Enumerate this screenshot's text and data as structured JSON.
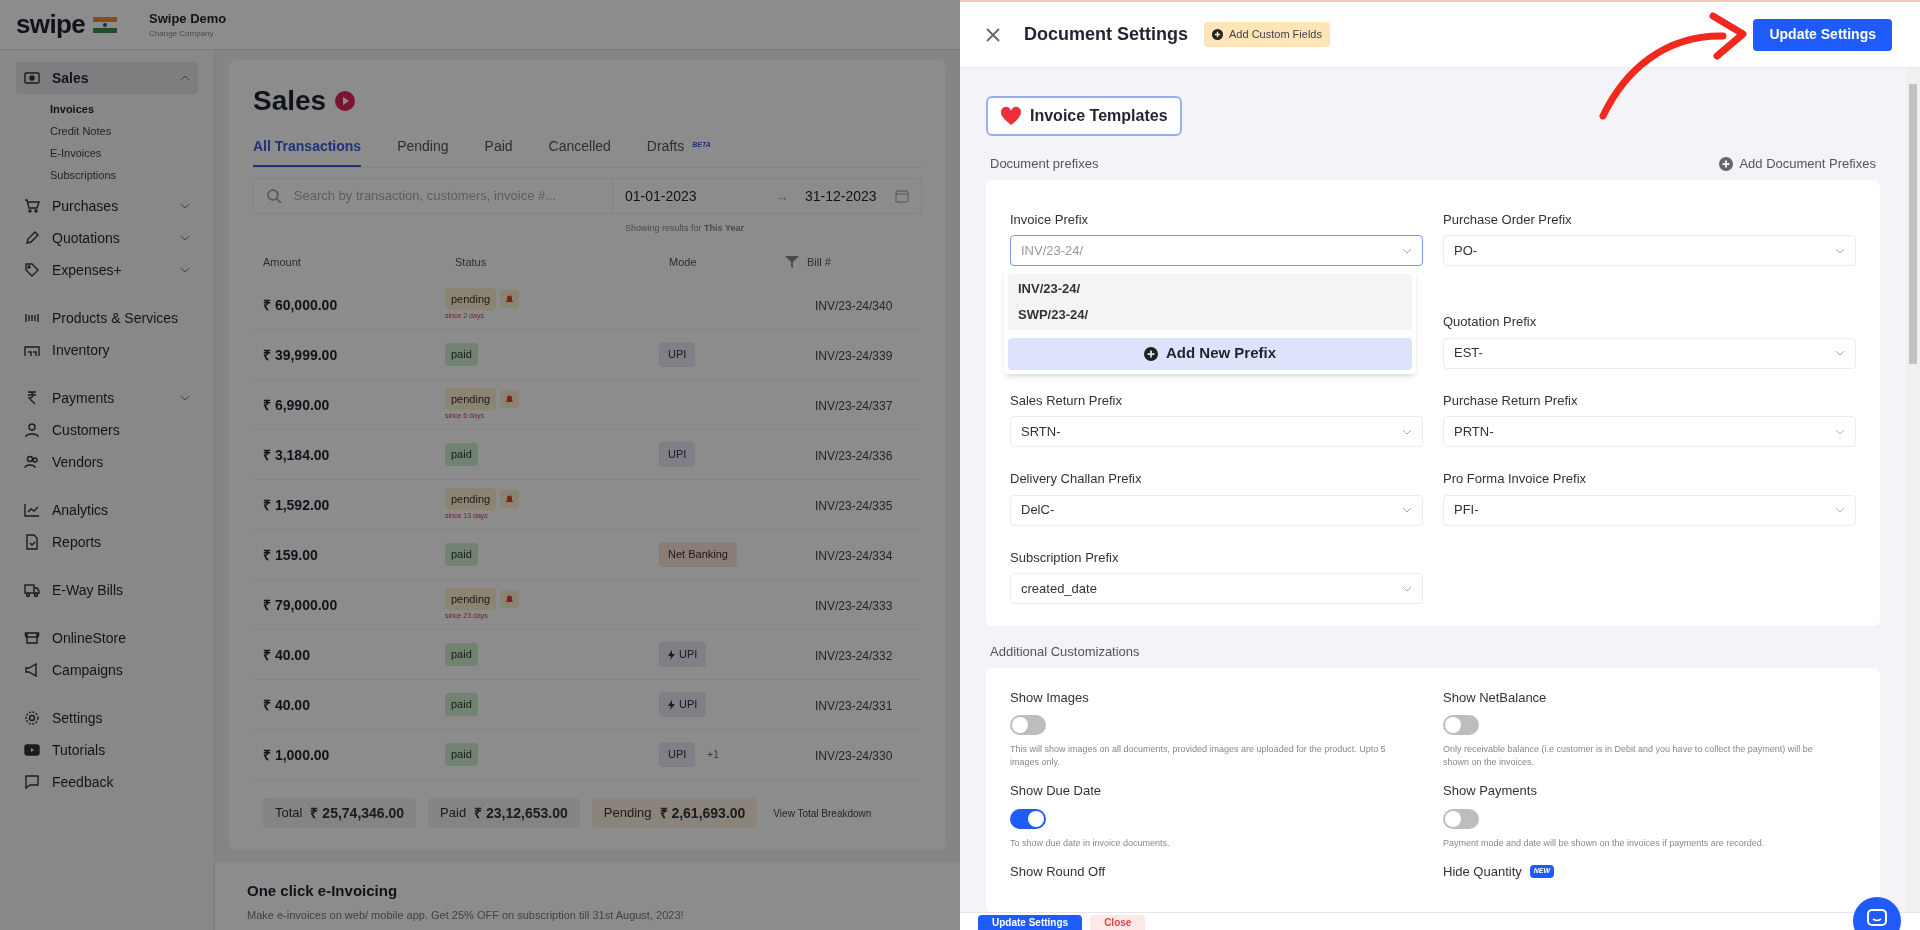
{
  "app": {
    "logo": "swipe",
    "company": "Swipe Demo",
    "change_company": "Change Company"
  },
  "sidebar": {
    "groups": [
      [
        {
          "label": "Sales",
          "selected": true,
          "expanded": true,
          "children": [
            {
              "label": "Invoices",
              "selected": true
            },
            {
              "label": "Credit Notes",
              "selected": false
            },
            {
              "label": "E-Invoices",
              "selected": false
            },
            {
              "label": "Subscriptions",
              "selected": false
            }
          ]
        },
        {
          "label": "Purchases",
          "selected": false,
          "expanded": false
        },
        {
          "label": "Quotations",
          "selected": false,
          "expanded": false
        },
        {
          "label": "Expenses+",
          "selected": false,
          "expanded": false
        }
      ],
      [
        {
          "label": "Products & Services",
          "selected": false
        },
        {
          "label": "Inventory",
          "selected": false
        }
      ],
      [
        {
          "label": "Payments",
          "selected": false,
          "expanded": false
        },
        {
          "label": "Customers",
          "selected": false
        },
        {
          "label": "Vendors",
          "selected": false
        }
      ],
      [
        {
          "label": "Analytics",
          "selected": false
        },
        {
          "label": "Reports",
          "selected": false
        }
      ],
      [
        {
          "label": "E-Way Bills",
          "selected": false
        }
      ],
      [
        {
          "label": "OnlineStore",
          "selected": false
        },
        {
          "label": "Campaigns",
          "selected": false
        }
      ],
      [
        {
          "label": "Settings",
          "selected": false
        },
        {
          "label": "Tutorials",
          "selected": false
        },
        {
          "label": "Feedback",
          "selected": false
        }
      ]
    ]
  },
  "page": {
    "title": "Sales",
    "tabs": [
      {
        "label": "All Transactions",
        "selected": true
      },
      {
        "label": "Pending",
        "selected": false
      },
      {
        "label": "Paid",
        "selected": false
      },
      {
        "label": "Cancelled",
        "selected": false
      },
      {
        "label": "Drafts",
        "selected": false,
        "badge": "BETA"
      }
    ],
    "search": {
      "placeholder": "Search by transaction, customers, invoice #..."
    },
    "date_from": "01-01-2023",
    "date_separator": "→",
    "date_to": "31-12-2023",
    "date_note": "Showing results for **This Year**",
    "table": {
      "columns": [
        "Amount",
        "Status",
        "Mode",
        "Bill #"
      ],
      "rows": [
        {
          "amount": "₹ 60,000.00",
          "status": "pending",
          "since": "since 2 days",
          "bill": "INV/23-24/340"
        },
        {
          "amount": "₹ 39,999.00",
          "status": "paid",
          "mode": {
            "label": "UPI",
            "kind": "upi"
          },
          "bill": "INV/23-24/339"
        },
        {
          "amount": "₹ 6,990.00",
          "status": "pending",
          "since": "since 6 days",
          "bill": "INV/23-24/337"
        },
        {
          "amount": "₹ 3,184.00",
          "status": "paid",
          "mode": {
            "label": "UPI",
            "kind": "upi"
          },
          "bill": "INV/23-24/336"
        },
        {
          "amount": "₹ 1,592.00",
          "status": "pending",
          "since": "since 13 days",
          "bill": "INV/23-24/335"
        },
        {
          "amount": "₹ 159.00",
          "status": "paid",
          "mode": {
            "label": "Net Banking",
            "kind": "netbanking"
          },
          "bill": "INV/23-24/334"
        },
        {
          "amount": "₹ 79,000.00",
          "status": "pending",
          "since": "since 23 days",
          "bill": "INV/23-24/333"
        },
        {
          "amount": "₹ 40.00",
          "status": "paid",
          "mode": {
            "label": "UPI",
            "kind": "upi_instant"
          },
          "bill": "INV/23-24/332"
        },
        {
          "amount": "₹ 40.00",
          "status": "paid",
          "mode": {
            "label": "UPI",
            "kind": "upi_instant"
          },
          "bill": "INV/23-24/331"
        },
        {
          "amount": "₹ 1,000.00",
          "status": "paid",
          "mode": {
            "label": "UPI",
            "kind": "upi",
            "extra": "+1"
          },
          "bill": "INV/23-24/330"
        }
      ]
    },
    "totals": [
      {
        "label": "Total",
        "value": "₹ 25,74,346.00",
        "kind": "total"
      },
      {
        "label": "Paid",
        "value": "₹ 23,12,653.00",
        "kind": "paid"
      },
      {
        "label": "Pending",
        "value": "₹ 2,61,693.00",
        "kind": "pending"
      }
    ],
    "breakdown_link": "View Total Breakdown",
    "promo": {
      "title": "One click e-Invoicing",
      "text": "Make e-invoices on web/ mobile app. Get 25% OFF on subscription till 31st August, 2023!"
    }
  },
  "drawer": {
    "title": "Document Settings",
    "custom_fields": "Add Custom Fields",
    "update_button": "Update Settings",
    "templates_button": "Invoice Templates",
    "prefixes_title": "Document prefixes",
    "add_prefixes": "Add Document Prefixes",
    "prefixes": [
      {
        "label": "Invoice Prefix",
        "value": "INV/23-24/",
        "focused": true
      },
      {
        "label": "Purchase Order Prefix",
        "value": "PO-",
        "focused": false
      },
      {
        "label": "Quotation Prefix",
        "value": "EST-",
        "focused": false
      },
      {
        "label": "Sales Return Prefix",
        "value": "SRTN-",
        "focused": false
      },
      {
        "label": "Purchase Return Prefix",
        "value": "PRTN-",
        "focused": false
      },
      {
        "label": "Delivery Challan Prefix",
        "value": "DelC-",
        "focused": false
      },
      {
        "label": "Pro Forma Invoice Prefix",
        "value": "PFI-",
        "focused": false
      },
      {
        "label": "Subscription Prefix",
        "value": "created_date",
        "focused": false
      }
    ],
    "dropdown": {
      "options": [
        "INV/23-24/",
        "SWP/23-24/"
      ],
      "add_label": "Add New Prefix"
    },
    "custom_title": "Additional Customizations",
    "toggles": [
      {
        "label": "Show Images",
        "on": false,
        "description": "This will show images on all documents, provided images are uploaded for the product. Upto 5 images only."
      },
      {
        "label": "Show NetBalance",
        "on": false,
        "description": "Only receivable balance (i.e customer is in Debit and you have to collect the payment) will be shown on the invoices."
      },
      {
        "label": "Show Due Date",
        "on": true,
        "description": "To show due date in invoice documents."
      },
      {
        "label": "Show Payments",
        "on": false,
        "description": "Payment mode and date will be shown on the invoices if payments are recorded."
      },
      {
        "label": "Show Round Off"
      },
      {
        "label": "Hide Quantity",
        "badge": "NEW"
      }
    ],
    "footer_buttons": [
      {
        "label": "Update Settings",
        "kind": "primary"
      },
      {
        "label": "Close",
        "kind": "danger"
      }
    ]
  }
}
